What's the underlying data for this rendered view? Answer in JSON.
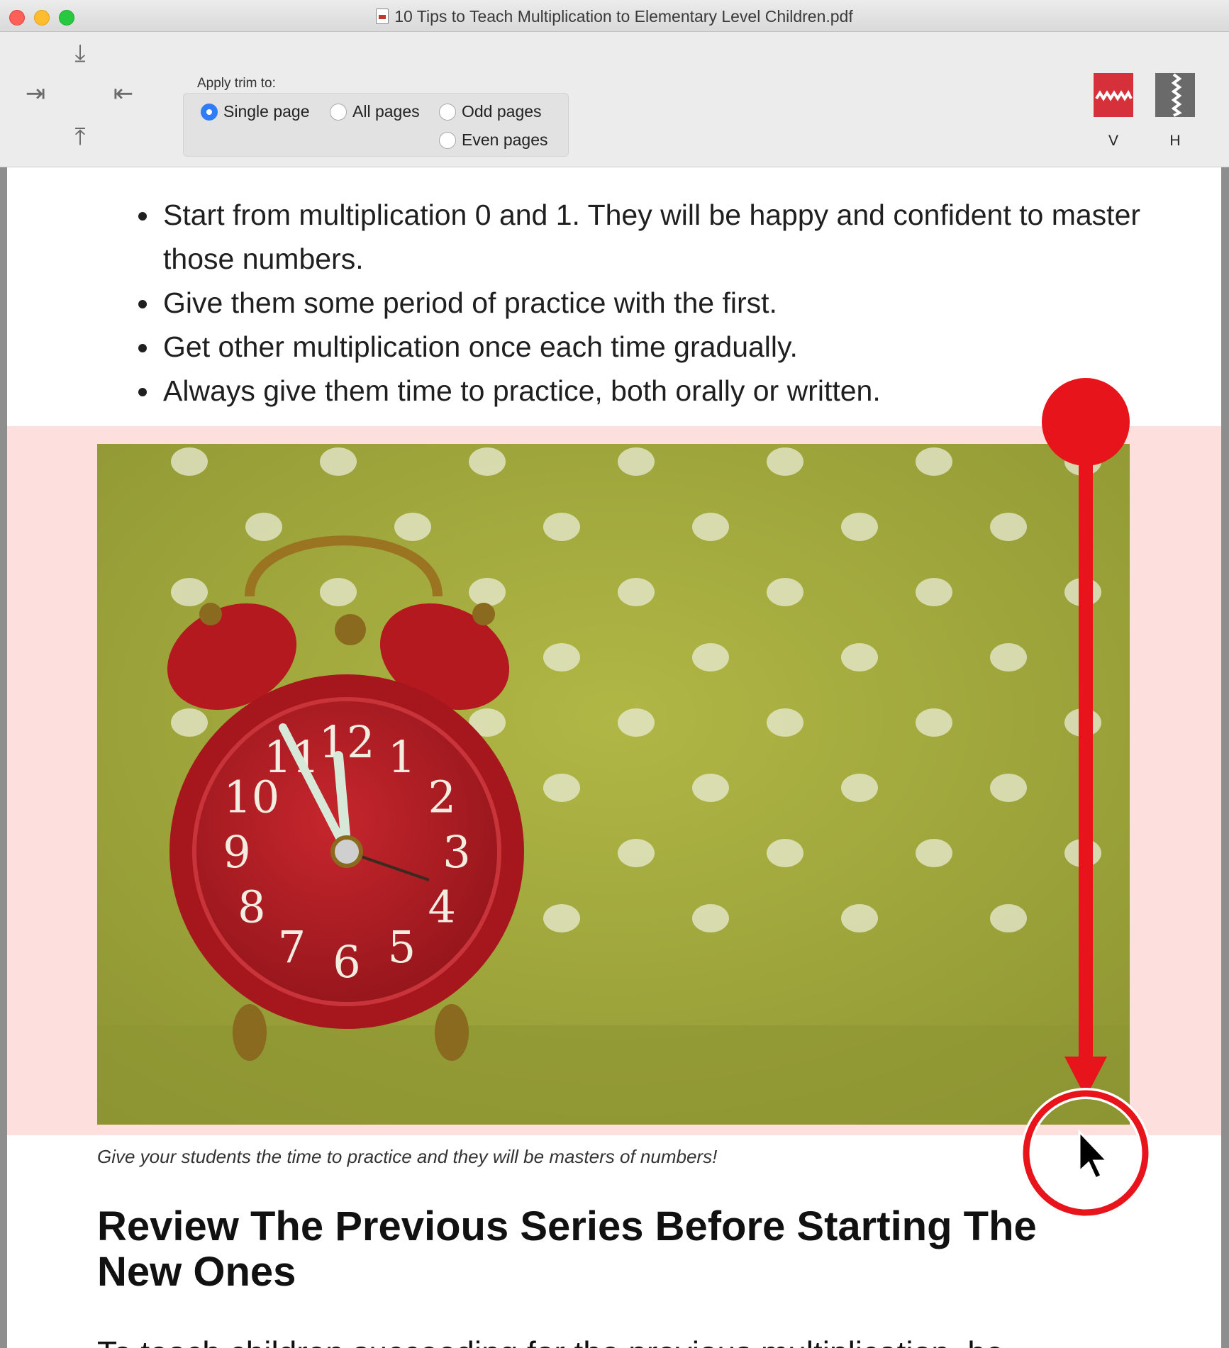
{
  "window": {
    "title": "10 Tips to Teach Multiplication to Elementary Level Children.pdf"
  },
  "toolbar": {
    "trim_arrows": {
      "down": "⤓",
      "right": "⇥",
      "left": "⇤",
      "up": "⤒"
    },
    "apply_trim_label": "Apply trim to:",
    "options": [
      {
        "label": "Single page",
        "selected": true
      },
      {
        "label": "All pages",
        "selected": false
      },
      {
        "label": "Odd pages",
        "selected": false
      },
      {
        "label": "Even pages",
        "selected": false
      }
    ],
    "mode_v_label": "V",
    "mode_h_label": "H",
    "accent_color": "#d6313a"
  },
  "content": {
    "bullets": [
      "Start from multiplication 0 and 1. They will be happy and confident to master those numbers.",
      "Give them some period of practice with the first.",
      "Get other multiplication once each time gradually.",
      "Always give them time to practice, both orally or written."
    ],
    "caption": "Give your students the time to practice and they will be masters of numbers!",
    "heading": "Review The Previous Series Before Starting The New Ones",
    "partial_line": "To teach children succeeding for the previous multiplication, be"
  },
  "annotation": {
    "color": "#e8141b"
  }
}
